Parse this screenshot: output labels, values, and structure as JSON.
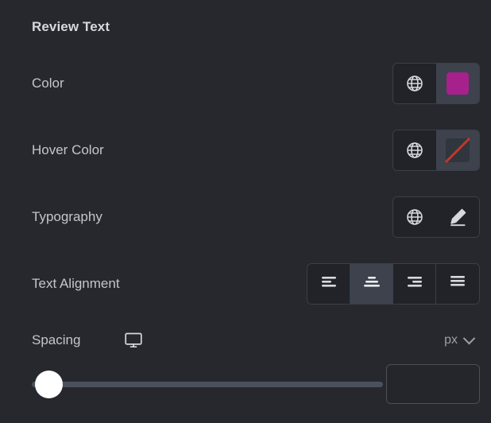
{
  "panel": {
    "section_title": "Review Text"
  },
  "colors": {
    "background": "#26282d",
    "control_dark": "#212329",
    "control_light": "#3d424d",
    "border": "#3a3f49",
    "label_text": "#c2c6cc",
    "title_text": "#d5d8dc",
    "swatch_color": "#a6218c",
    "empty_slash": "#c0392b",
    "slider_track": "#4b515c",
    "slider_handle": "#ffffff",
    "icon": "#d5d8dc",
    "unit_text": "#9ba0a9"
  },
  "rows": [
    {
      "label": "Color",
      "globe_icon": "globe-icon",
      "control_type": "color-swatch",
      "value": "#a6218c"
    },
    {
      "label": "Hover Color",
      "globe_icon": "globe-icon",
      "control_type": "color-swatch-empty",
      "value": ""
    },
    {
      "label": "Typography",
      "globe_icon": "globe-icon",
      "control_type": "edit-pencil",
      "value": ""
    }
  ],
  "text_alignment": {
    "label": "Text Alignment",
    "selected": "center",
    "options": [
      {
        "name": "left",
        "icon": "align-left-icon"
      },
      {
        "name": "center",
        "icon": "align-center-icon"
      },
      {
        "name": "right",
        "icon": "align-right-icon"
      },
      {
        "name": "justify",
        "icon": "align-justify-icon"
      }
    ]
  },
  "spacing": {
    "label": "Spacing",
    "device_icon": "desktop-monitor-icon",
    "unit": "px",
    "unit_chevron": "chevron-down-icon",
    "slider_value": 0,
    "slider_min": 0,
    "slider_max": 100,
    "input_value": "",
    "input_placeholder": ""
  }
}
